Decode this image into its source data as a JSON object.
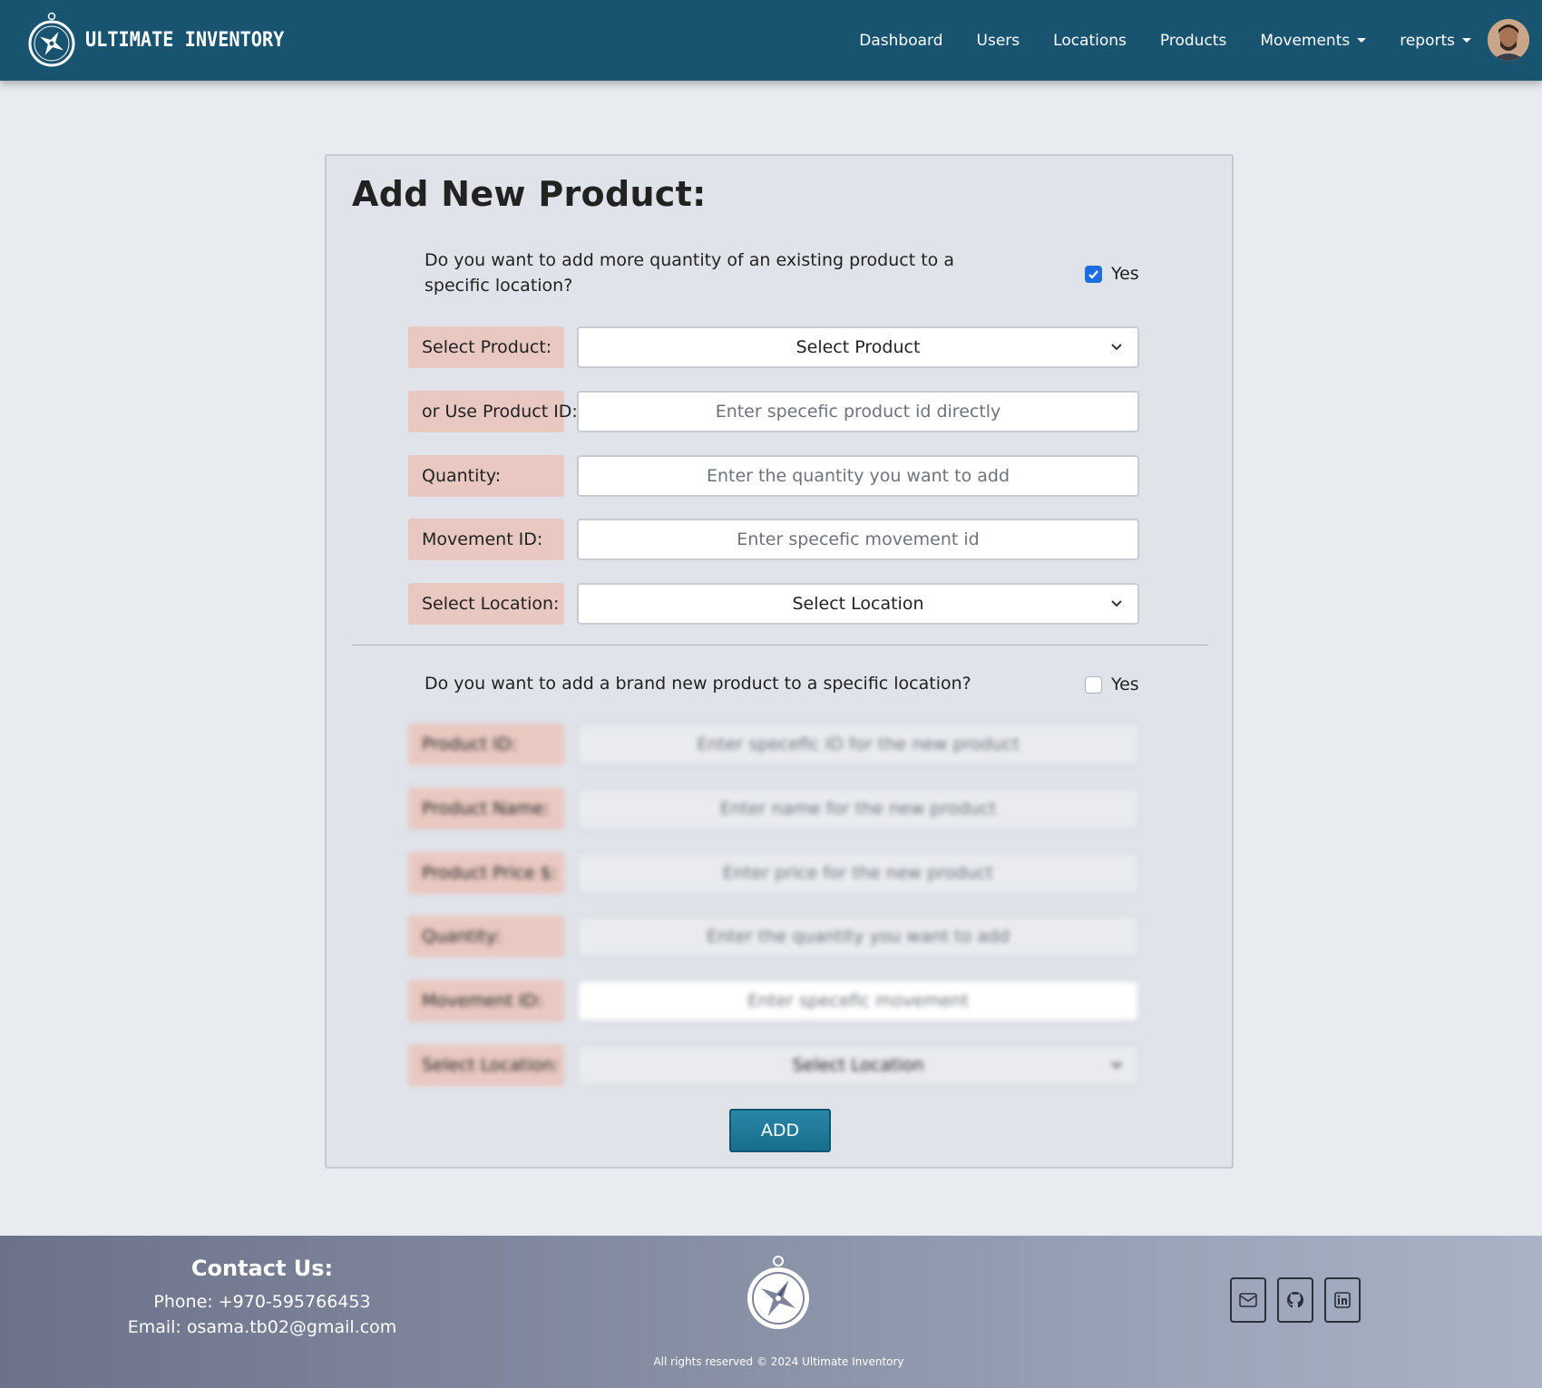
{
  "brand": {
    "name": "ULTIMATE INVENTORY"
  },
  "nav": {
    "items": [
      {
        "label": "Dashboard"
      },
      {
        "label": "Users"
      },
      {
        "label": "Locations"
      },
      {
        "label": "Products"
      },
      {
        "label": "Movements"
      },
      {
        "label": "reports"
      }
    ]
  },
  "form": {
    "title": "Add New Product:",
    "existing": {
      "question": "Do you want to add more quantity of an existing product to a specific location?",
      "check_label": "Yes",
      "checked": true,
      "product_label": "Select Product:",
      "product_select": "Select Product",
      "product_id_label": "or Use Product ID:",
      "product_id_placeholder": "Enter specefic product id directly",
      "quantity_label": "Quantity:",
      "quantity_placeholder": "Enter the quantity you want to add",
      "movement_label": "Movement ID:",
      "movement_placeholder": "Enter specefic movement id",
      "location_label": "Select Location:",
      "location_select": "Select Location"
    },
    "new": {
      "question": "Do you want to add a brand new product to a specific location?",
      "check_label": "Yes",
      "checked": false,
      "product_id_label": "Product ID:",
      "product_id_placeholder": "Enter specefic ID for the new product",
      "name_label": "Product Name:",
      "name_placeholder": "Enter name for the new product",
      "price_label": "Product Price $:",
      "price_placeholder": "Enter price for the new product",
      "quantity_label": "Quantity:",
      "quantity_placeholder": "Enter the quantity you want to add",
      "movement_label": "Movement ID:",
      "movement_placeholder": "Enter specefic movement",
      "location_label": "Select Location:",
      "location_select": "Select Location"
    },
    "submit_label": "ADD"
  },
  "footer": {
    "contact_title": "Contact Us:",
    "phone": "Phone: +970-595766453",
    "email": "Email: osama.tb02@gmail.com",
    "copyright": "All rights reserved © 2024 Ultimate Inventory",
    "social_icons": [
      "mail-icon",
      "github-icon",
      "linkedin-icon"
    ]
  },
  "colors": {
    "navbar": "#18536f",
    "label_bg": "#e8c8c0",
    "button": "#1f7a9a",
    "checkbox": "#1b6ee3"
  }
}
